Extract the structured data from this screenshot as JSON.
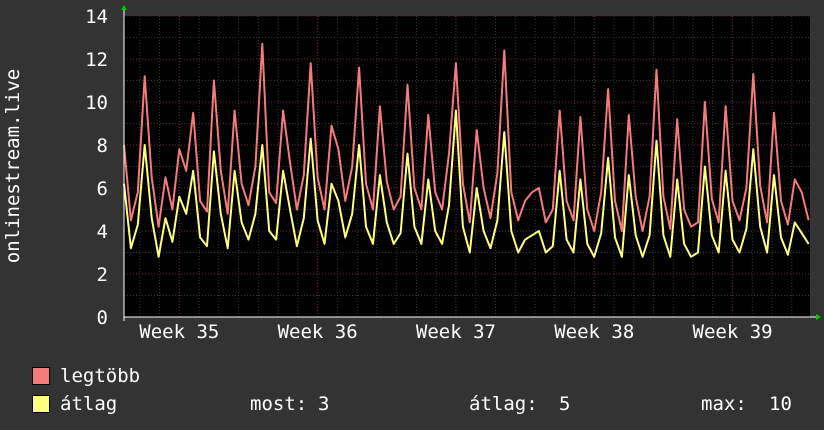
{
  "chart_data": {
    "type": "line",
    "ylabel": "onlinestream.live",
    "ylim": [
      0,
      14
    ],
    "yticks": [
      0,
      2,
      4,
      6,
      8,
      10,
      12,
      14
    ],
    "xlim": [
      34.6,
      39.56
    ],
    "xticks": [
      {
        "label": "Week 35",
        "value": 35
      },
      {
        "label": "Week 36",
        "value": 36
      },
      {
        "label": "Week 37",
        "value": 37
      },
      {
        "label": "Week 38",
        "value": 38
      },
      {
        "label": "Week 39",
        "value": 39
      }
    ],
    "grid": true,
    "colors": {
      "background": "#333333",
      "plot_background": "#000000",
      "grid_minor": "#3a3a3a",
      "grid_major": "#6e2a2a",
      "axis": "#ffffff",
      "arrow": "#00cc00",
      "legtobb": "#f47b7b",
      "atlag": "#ffff80"
    },
    "series": [
      {
        "name": "legtöbb",
        "color": "#f47b7b",
        "x": [
          34.6,
          34.65,
          34.7,
          34.75,
          34.8,
          34.85,
          34.9,
          34.95,
          35.0,
          35.05,
          35.1,
          35.15,
          35.2,
          35.25,
          35.3,
          35.35,
          35.4,
          35.45,
          35.5,
          35.55,
          35.6,
          35.65,
          35.7,
          35.75,
          35.8,
          35.85,
          35.9,
          35.95,
          36.0,
          36.05,
          36.1,
          36.15,
          36.2,
          36.25,
          36.3,
          36.35,
          36.4,
          36.45,
          36.5,
          36.55,
          36.6,
          36.65,
          36.7,
          36.75,
          36.8,
          36.85,
          36.9,
          36.95,
          37.0,
          37.05,
          37.1,
          37.15,
          37.2,
          37.25,
          37.3,
          37.35,
          37.4,
          37.45,
          37.5,
          37.55,
          37.6,
          37.65,
          37.7,
          37.75,
          37.8,
          37.85,
          37.9,
          37.95,
          38.0,
          38.05,
          38.1,
          38.15,
          38.2,
          38.25,
          38.3,
          38.35,
          38.4,
          38.45,
          38.5,
          38.55,
          38.6,
          38.65,
          38.7,
          38.75,
          38.8,
          38.85,
          38.9,
          38.95,
          39.0,
          39.05,
          39.1,
          39.15,
          39.2,
          39.25,
          39.3,
          39.35,
          39.4,
          39.45,
          39.5,
          39.55
        ],
        "values": [
          8.0,
          4.5,
          5.8,
          11.2,
          6.5,
          4.2,
          6.5,
          5.0,
          7.8,
          6.8,
          9.5,
          5.4,
          4.9,
          11.0,
          6.8,
          4.8,
          9.6,
          6.2,
          5.2,
          7.0,
          12.7,
          5.8,
          5.3,
          9.6,
          7.2,
          5.0,
          6.6,
          11.8,
          6.5,
          5.0,
          8.9,
          7.8,
          5.4,
          7.0,
          11.6,
          6.2,
          5.0,
          9.8,
          6.3,
          5.0,
          5.6,
          10.8,
          6.0,
          5.0,
          9.4,
          5.8,
          5.0,
          7.6,
          11.8,
          6.2,
          4.4,
          8.7,
          6.0,
          4.6,
          6.7,
          12.4,
          5.8,
          4.5,
          5.4,
          5.8,
          6.0,
          4.4,
          5.0,
          9.6,
          5.4,
          4.5,
          9.3,
          5.0,
          4.0,
          5.8,
          10.6,
          5.4,
          4.0,
          9.4,
          5.6,
          4.0,
          5.6,
          11.5,
          5.6,
          4.1,
          9.2,
          5.0,
          4.2,
          4.4,
          10.0,
          5.5,
          4.4,
          9.8,
          5.4,
          4.5,
          6.0,
          11.3,
          6.1,
          4.4,
          9.5,
          5.4,
          4.3,
          6.4,
          5.8,
          4.5
        ]
      },
      {
        "name": "átlag",
        "color": "#ffff80",
        "x": [
          34.6,
          34.65,
          34.7,
          34.75,
          34.8,
          34.85,
          34.9,
          34.95,
          35.0,
          35.05,
          35.1,
          35.15,
          35.2,
          35.25,
          35.3,
          35.35,
          35.4,
          35.45,
          35.5,
          35.55,
          35.6,
          35.65,
          35.7,
          35.75,
          35.8,
          35.85,
          35.9,
          35.95,
          36.0,
          36.05,
          36.1,
          36.15,
          36.2,
          36.25,
          36.3,
          36.35,
          36.4,
          36.45,
          36.5,
          36.55,
          36.6,
          36.65,
          36.7,
          36.75,
          36.8,
          36.85,
          36.9,
          36.95,
          37.0,
          37.05,
          37.1,
          37.15,
          37.2,
          37.25,
          37.3,
          37.35,
          37.4,
          37.45,
          37.5,
          37.55,
          37.6,
          37.65,
          37.7,
          37.75,
          37.8,
          37.85,
          37.9,
          37.95,
          38.0,
          38.05,
          38.1,
          38.15,
          38.2,
          38.25,
          38.3,
          38.35,
          38.4,
          38.45,
          38.5,
          38.55,
          38.6,
          38.65,
          38.7,
          38.75,
          38.8,
          38.85,
          38.9,
          38.95,
          39.0,
          39.05,
          39.1,
          39.15,
          39.2,
          39.25,
          39.3,
          39.35,
          39.4,
          39.45,
          39.5,
          39.55
        ],
        "values": [
          6.2,
          3.2,
          4.3,
          8.0,
          4.6,
          2.8,
          4.6,
          3.5,
          5.6,
          4.8,
          6.8,
          3.7,
          3.3,
          7.7,
          4.8,
          3.2,
          6.8,
          4.4,
          3.6,
          4.8,
          8.0,
          4.0,
          3.6,
          6.8,
          5.0,
          3.3,
          4.6,
          8.3,
          4.5,
          3.4,
          6.2,
          5.4,
          3.7,
          4.8,
          8.0,
          4.2,
          3.4,
          6.6,
          4.4,
          3.4,
          3.9,
          7.6,
          4.2,
          3.4,
          6.4,
          4.0,
          3.4,
          5.2,
          9.6,
          4.2,
          3.0,
          6.0,
          4.0,
          3.2,
          4.5,
          8.6,
          4.0,
          3.0,
          3.6,
          3.8,
          4.0,
          3.0,
          3.3,
          6.8,
          3.6,
          3.0,
          6.4,
          3.4,
          2.8,
          3.9,
          7.4,
          3.7,
          2.8,
          6.6,
          3.8,
          2.8,
          3.8,
          8.2,
          3.8,
          2.8,
          6.4,
          3.4,
          2.8,
          3.0,
          7.0,
          3.8,
          3.0,
          6.8,
          3.6,
          3.0,
          4.1,
          7.8,
          4.2,
          3.0,
          6.6,
          3.7,
          2.9,
          4.4,
          3.9,
          3.4
        ]
      }
    ],
    "legend": [
      {
        "name": "legtöbb",
        "color": "#f47b7b"
      },
      {
        "name": "átlag",
        "color": "#ffff80"
      }
    ],
    "stats": {
      "most_label": "most:",
      "most_value": "3",
      "atlag_label": "átlag:",
      "atlag_value": "5",
      "max_label": "max:",
      "max_value": "10"
    }
  }
}
